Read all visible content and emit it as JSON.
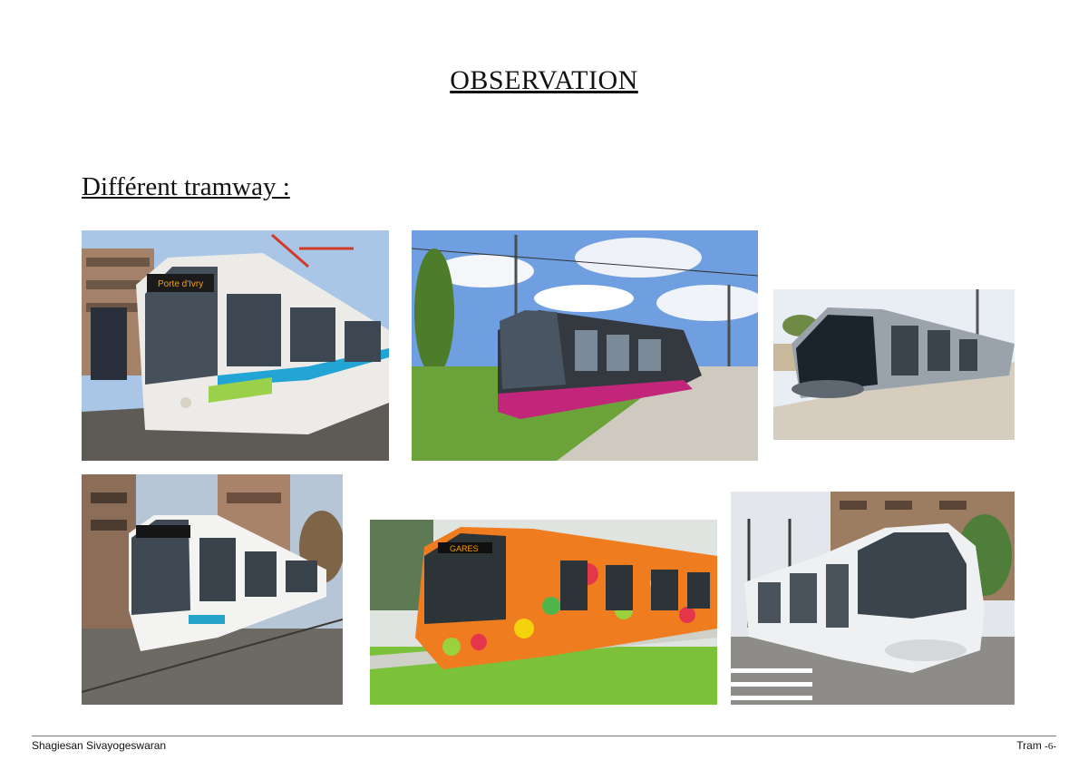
{
  "page": {
    "title": "OBSERVATION",
    "subtitle": "Différent tramway :"
  },
  "photos": [
    {
      "icon": "tram-photo-paris-t3",
      "destination_sign": "Porte d'Ivry"
    },
    {
      "icon": "tram-photo-pink-tram"
    },
    {
      "icon": "tram-photo-silver-tram"
    },
    {
      "icon": "tram-photo-white-tram-city"
    },
    {
      "icon": "tram-photo-flower-tram",
      "destination_sign": "GARES"
    },
    {
      "icon": "tram-photo-lyon-tram"
    }
  ],
  "footer": {
    "author": "Shagiesan Sivayogeswaran",
    "label": "Tram",
    "page_number": "-6-"
  },
  "colors": {
    "sky": "#8fb6e8",
    "grass": "#5a9a2e",
    "pink_skirt": "#c2267a",
    "footer_rule": "#777777"
  }
}
